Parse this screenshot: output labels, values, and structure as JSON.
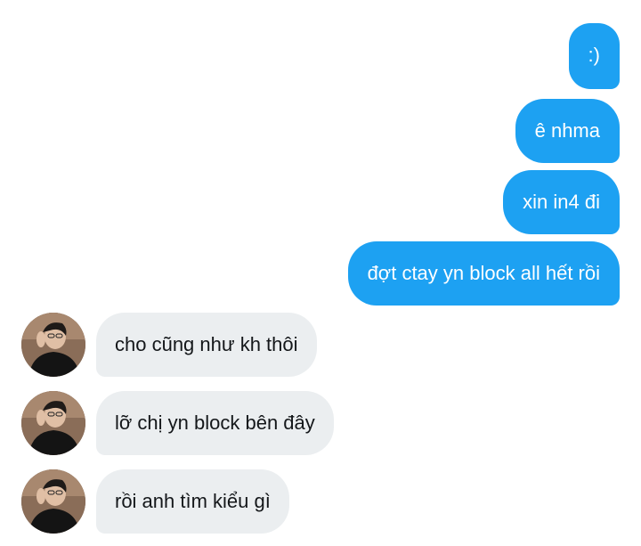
{
  "conversation": {
    "outgoing": [
      {
        "text": ":)"
      },
      {
        "text": "ê nhma"
      },
      {
        "text": "xin in4 đi"
      },
      {
        "text": "đợt ctay yn block all hết rồi"
      }
    ],
    "incoming": [
      {
        "text": "cho cũng như kh thôi"
      },
      {
        "text": "lỡ chị yn block bên đây"
      },
      {
        "text": "rồi anh tìm kiểu gì"
      }
    ]
  },
  "colors": {
    "outgoing_bubble": "#1da1f2",
    "incoming_bubble": "#ebeef0",
    "background": "#ffffff"
  },
  "icons": {
    "avatar": "profile-photo-avatar"
  }
}
